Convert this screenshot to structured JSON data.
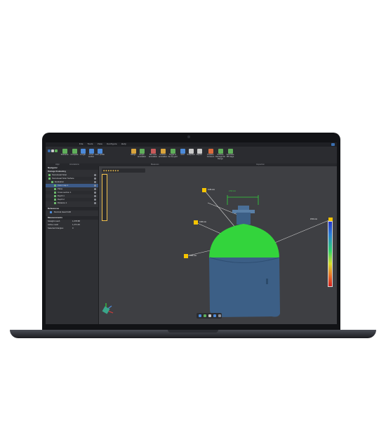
{
  "app": {
    "menu": [
      "File",
      "Tools",
      "View",
      "Configure",
      "Help"
    ]
  },
  "ribbon": {
    "buttons": [
      {
        "label": "Tolerance",
        "color": "#5fae5a"
      },
      {
        "label": "Compare",
        "color": "#5fae5a"
      },
      {
        "label": "Length",
        "color": "#4c8ad9"
      },
      {
        "label": "Cross section",
        "color": "#4c8ad9"
      },
      {
        "label": "Color profile",
        "color": "#4c8ad9"
      },
      {
        "label": "Merge",
        "color": "#d9a43c"
      },
      {
        "label": "Depth annotation",
        "color": "#5fae5a"
      },
      {
        "label": "Min-max annotation",
        "color": "#c75a5a"
      },
      {
        "label": "Custom annotation",
        "color": "#d9a43c"
      },
      {
        "label": "Toggle in the top grid",
        "color": "#5fae5a"
      },
      {
        "label": "Grid",
        "color": "#4c8ad9"
      },
      {
        "label": "Snapshot",
        "color": "#c9c9c9"
      },
      {
        "label": "Report",
        "color": "#c9c9c9"
      },
      {
        "label": "Position Contours",
        "color": "#d96a3c"
      },
      {
        "label": "Surface Damage Re Range",
        "color": "#5fae5a"
      },
      {
        "label": "Generate PB Gage",
        "color": "#5fae5a"
      }
    ],
    "groups": [
      "Align",
      "Annotations",
      "Measures",
      "Inspection"
    ]
  },
  "panel": {
    "title": "Navigator",
    "project": "Damage Evaluating",
    "tree": [
      {
        "label": "Scan-Head Scan",
        "indent": 4,
        "state": ""
      },
      {
        "label": "Scan-Head Scan Surface",
        "indent": 4,
        "state": ""
      },
      {
        "label": "Evaluation",
        "indent": 8,
        "state": ""
      },
      {
        "label": "Color map 1",
        "indent": 12,
        "state": "sel"
      },
      {
        "label": "Plane",
        "indent": 12,
        "state": ""
      },
      {
        "label": "Cross section 1",
        "indent": 12,
        "state": ""
      },
      {
        "label": "Depth 1",
        "indent": 12,
        "state": ""
      },
      {
        "label": "Depth 2",
        "indent": 12,
        "state": ""
      },
      {
        "label": "Distance 1",
        "indent": 12,
        "state": ""
      }
    ],
    "references_title": "References",
    "references": [
      "Nominal Head CAD"
    ],
    "measures_title": "Measurements",
    "measures": [
      {
        "label": "Straight mesh",
        "value": "1,078.88"
      },
      {
        "label": "Active mesh",
        "value": "1,271.46"
      },
      {
        "label": "Selected triangles",
        "value": "0"
      }
    ]
  },
  "viewport": {
    "toolbar_text": "◆◆◆◆◆◆◆",
    "tags": [
      {
        "text": "3.29 mm",
        "box": "tag-1",
        "label": "tag-1-text"
      },
      {
        "text": "3.06 mm",
        "box": "tag-2",
        "label": "tag-2-text"
      },
      {
        "text": "4.84 mm",
        "box": "tag-3",
        "label": "tag-3-text"
      },
      {
        "text": "0.54 mm",
        "box": "tag-4",
        "label": "tag-4-text"
      },
      {
        "text": "2.64 mm",
        "box": "tag-5",
        "label": "tag-5-text"
      }
    ],
    "colors": {
      "vessel_top": "#33d43c",
      "vessel_body": "#3c5f86",
      "leader": "#cfcfcf",
      "tag": "#f5c400"
    }
  }
}
